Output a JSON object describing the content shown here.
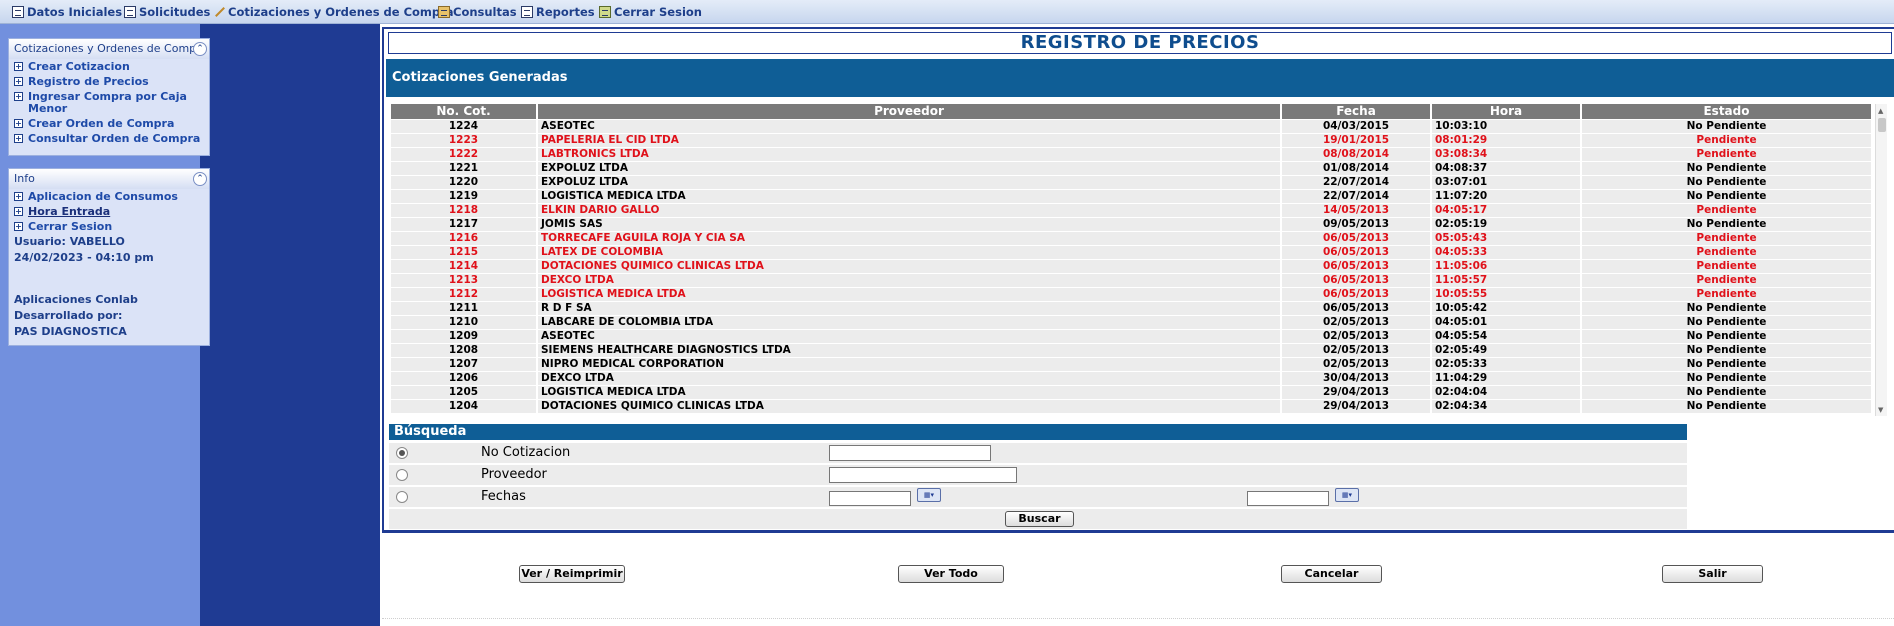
{
  "topmenu": [
    {
      "label": "Datos Iniciales",
      "icon": "document-icon"
    },
    {
      "label": "Solicitudes",
      "icon": "document-icon"
    },
    {
      "label": "Cotizaciones y Ordenes de Compra",
      "icon": "pencil-icon"
    },
    {
      "label": "Consultas",
      "icon": "search-bin-icon"
    },
    {
      "label": "Reportes",
      "icon": "document-icon"
    },
    {
      "label": "Cerrar Sesion",
      "icon": "exit-icon"
    }
  ],
  "sidebar": {
    "panel1": {
      "title": "Cotizaciones y Ordenes de Compra",
      "items": [
        "Crear Cotizacion",
        "Registro de Precios",
        "Ingresar Compra por Caja Menor",
        "Crear Orden de Compra",
        "Consultar Orden de Compra"
      ]
    },
    "panel2": {
      "title": "Info",
      "items": [
        "Aplicacion de Consumos",
        "Hora Entrada",
        "Cerrar Sesion"
      ],
      "user": "Usuario: VABELLO",
      "datetime": "24/02/2023 - 04:10 pm",
      "app": "Aplicaciones Conlab",
      "dev_label": "Desarrollado por:",
      "dev": "PAS DIAGNOSTICA"
    }
  },
  "main": {
    "title": "REGISTRO DE PRECIOS",
    "section": "Cotizaciones Generadas",
    "table": {
      "headers": [
        "No. Cot.",
        "Proveedor",
        "Fecha",
        "Hora",
        "Estado"
      ],
      "rows": [
        [
          "1224",
          "ASEOTEC",
          "04/03/2015",
          "10:03:10",
          "No Pendiente"
        ],
        [
          "1223",
          "PAPELERIA EL CID LTDA",
          "19/01/2015",
          "08:01:29",
          "Pendiente"
        ],
        [
          "1222",
          "LABTRONICS LTDA",
          "08/08/2014",
          "03:08:34",
          "Pendiente"
        ],
        [
          "1221",
          "EXPOLUZ LTDA",
          "01/08/2014",
          "04:08:37",
          "No Pendiente"
        ],
        [
          "1220",
          "EXPOLUZ LTDA",
          "22/07/2014",
          "03:07:01",
          "No Pendiente"
        ],
        [
          "1219",
          "LOGISTICA MEDICA LTDA",
          "22/07/2014",
          "11:07:20",
          "No Pendiente"
        ],
        [
          "1218",
          "ELKIN DARIO GALLO",
          "14/05/2013",
          "04:05:17",
          "Pendiente"
        ],
        [
          "1217",
          "JOMIS SAS",
          "09/05/2013",
          "02:05:19",
          "No Pendiente"
        ],
        [
          "1216",
          "TORRECAFE AGUILA ROJA Y CIA SA",
          "06/05/2013",
          "05:05:43",
          "Pendiente"
        ],
        [
          "1215",
          "LATEX DE COLOMBIA",
          "06/05/2013",
          "04:05:33",
          "Pendiente"
        ],
        [
          "1214",
          "DOTACIONES QUIMICO CLINICAS LTDA",
          "06/05/2013",
          "11:05:06",
          "Pendiente"
        ],
        [
          "1213",
          "DEXCO LTDA",
          "06/05/2013",
          "11:05:57",
          "Pendiente"
        ],
        [
          "1212",
          "LOGISTICA MEDICA LTDA",
          "06/05/2013",
          "10:05:55",
          "Pendiente"
        ],
        [
          "1211",
          "R D F SA",
          "06/05/2013",
          "10:05:42",
          "No Pendiente"
        ],
        [
          "1210",
          "LABCARE DE COLOMBIA LTDA",
          "02/05/2013",
          "04:05:01",
          "No Pendiente"
        ],
        [
          "1209",
          "ASEOTEC",
          "02/05/2013",
          "04:05:54",
          "No Pendiente"
        ],
        [
          "1208",
          "SIEMENS HEALTHCARE DIAGNOSTICS LTDA",
          "02/05/2013",
          "02:05:49",
          "No Pendiente"
        ],
        [
          "1207",
          "NIPRO MEDICAL CORPORATION",
          "02/05/2013",
          "02:05:33",
          "No Pendiente"
        ],
        [
          "1206",
          "DEXCO LTDA",
          "30/04/2013",
          "11:04:29",
          "No Pendiente"
        ],
        [
          "1205",
          "LOGISTICA MEDICA LTDA",
          "29/04/2013",
          "02:04:04",
          "No Pendiente"
        ],
        [
          "1204",
          "DOTACIONES QUIMICO CLINICAS LTDA",
          "29/04/2013",
          "02:04:34",
          "No Pendiente"
        ]
      ]
    },
    "search": {
      "title": "Búsqueda",
      "options": [
        "No Cotizacion",
        "Proveedor",
        "Fechas"
      ],
      "selected": "No Cotizacion",
      "button": "Buscar"
    },
    "actions": [
      "Ver / Reimprimir",
      "Ver Todo",
      "Cancelar",
      "Salir"
    ]
  },
  "colors": {
    "pendiente": "#e0111a",
    "brand_blue": "#0f5e96",
    "navy": "#1f3b93",
    "sidebar": "#7290de"
  }
}
